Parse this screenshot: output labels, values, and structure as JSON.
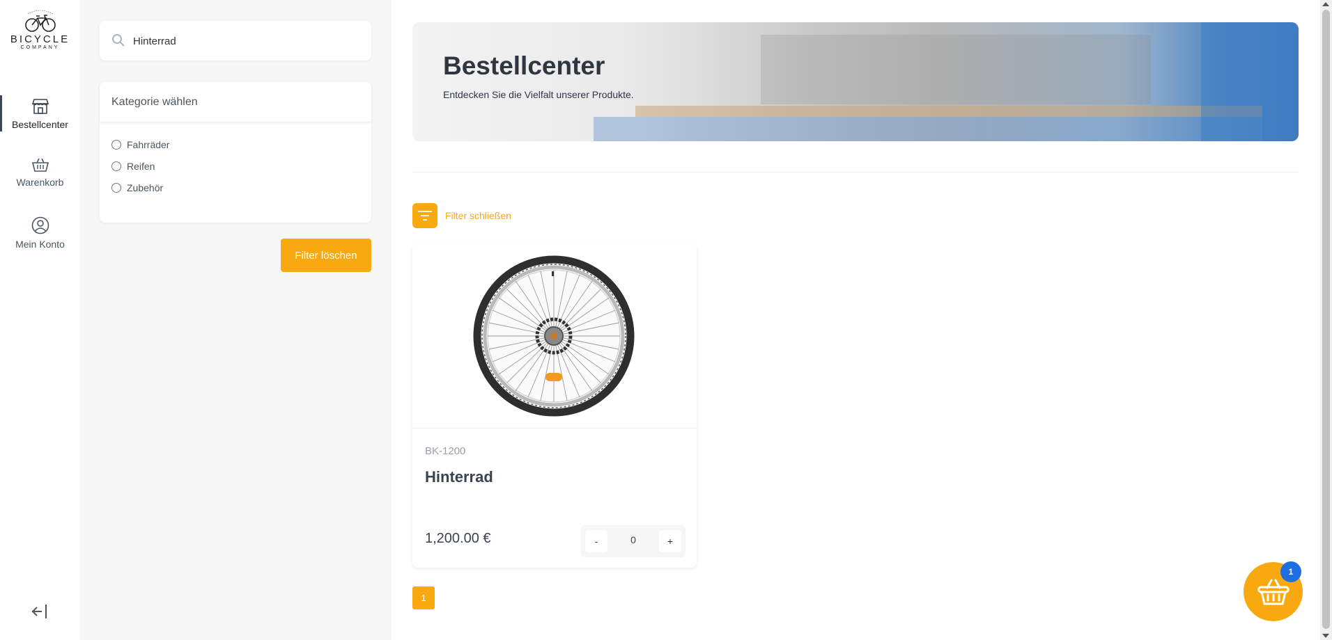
{
  "brand": {
    "name": "BICYCLE",
    "sub": "COMPANY"
  },
  "nav": {
    "items": [
      {
        "label": "Bestellcenter",
        "icon": "store-icon",
        "active": true
      },
      {
        "label": "Warenkorb",
        "icon": "basket-icon",
        "active": false
      },
      {
        "label": "Mein Konto",
        "icon": "user-circle-icon",
        "active": false
      }
    ],
    "logout_icon": "logout-icon"
  },
  "filters": {
    "search_value": "Hinterrad",
    "category_heading": "Kategorie wählen",
    "categories": [
      "Fahrräder",
      "Reifen",
      "Zubehör"
    ],
    "clear_label": "Filter löschen"
  },
  "hero": {
    "title": "Bestellcenter",
    "subtitle": "Entdecken Sie die Vielfalt unserer Produkte."
  },
  "filter_toggle_label": "Filter schließen",
  "products": [
    {
      "sku": "BK-1200",
      "name": "Hinterrad",
      "price": "1,200.00 €",
      "quantity": "0",
      "minus": "-",
      "plus": "+"
    }
  ],
  "pagination": {
    "current": "1"
  },
  "cart": {
    "count": "1"
  },
  "colors": {
    "accent": "#f8a90f",
    "badge": "#1f6fe0",
    "text": "#3a4350"
  }
}
